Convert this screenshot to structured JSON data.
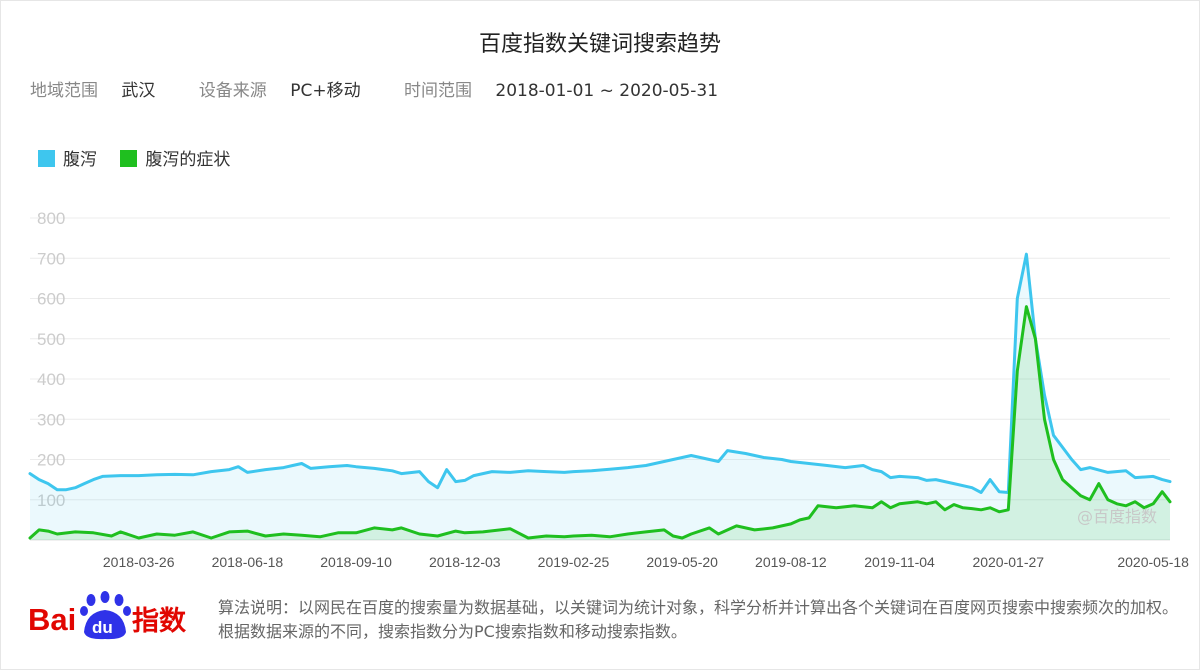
{
  "header": {
    "title": "百度指数关键词搜索趋势"
  },
  "filters": {
    "region_label": "地域范围",
    "region": "武汉",
    "device_label": "设备来源",
    "device": "PC+移动",
    "time_label": "时间范围",
    "time_range": "2018-01-01 ~ 2020-05-31"
  },
  "colors": {
    "series1": "#3ec6ee",
    "series2": "#1fbf1f"
  },
  "watermark": "@百度指数",
  "footer": {
    "logo_bai": "Bai",
    "logo_du": "du",
    "logo_zhishu": "指数",
    "note": "算法说明：以网民在百度的搜索量为数据基础，以关键词为统计对象，科学分析并计算出各个关键词在百度网页搜索中搜索频次的加权。根据数据来源的不同，搜索指数分为PC搜索指数和移动搜索指数。"
  },
  "chart_data": {
    "type": "area",
    "ylim": [
      0,
      800
    ],
    "yticks": [
      100,
      200,
      300,
      400,
      500,
      600,
      700,
      800
    ],
    "grid": true,
    "legend_position": "top-left",
    "x_start": "2018-01-01",
    "x_end": "2020-05-31",
    "xticks": [
      "2018-03-26",
      "2018-06-18",
      "2018-09-10",
      "2018-12-03",
      "2019-02-25",
      "2019-05-20",
      "2019-08-12",
      "2019-11-04",
      "2020-01-27",
      "2020-05-18"
    ],
    "series": [
      {
        "name": "腹泻",
        "points": [
          [
            "2018-01-01",
            165
          ],
          [
            "2018-01-08",
            150
          ],
          [
            "2018-01-15",
            140
          ],
          [
            "2018-01-22",
            125
          ],
          [
            "2018-01-29",
            125
          ],
          [
            "2018-02-05",
            130
          ],
          [
            "2018-02-12",
            140
          ],
          [
            "2018-02-19",
            150
          ],
          [
            "2018-02-26",
            158
          ],
          [
            "2018-03-12",
            160
          ],
          [
            "2018-03-26",
            160
          ],
          [
            "2018-04-09",
            162
          ],
          [
            "2018-04-23",
            163
          ],
          [
            "2018-05-07",
            162
          ],
          [
            "2018-05-21",
            170
          ],
          [
            "2018-06-04",
            175
          ],
          [
            "2018-06-11",
            182
          ],
          [
            "2018-06-18",
            168
          ],
          [
            "2018-07-02",
            175
          ],
          [
            "2018-07-16",
            180
          ],
          [
            "2018-07-23",
            185
          ],
          [
            "2018-07-30",
            190
          ],
          [
            "2018-08-06",
            178
          ],
          [
            "2018-08-20",
            182
          ],
          [
            "2018-09-03",
            185
          ],
          [
            "2018-09-10",
            182
          ],
          [
            "2018-09-24",
            178
          ],
          [
            "2018-10-08",
            172
          ],
          [
            "2018-10-15",
            165
          ],
          [
            "2018-10-29",
            170
          ],
          [
            "2018-11-05",
            145
          ],
          [
            "2018-11-12",
            130
          ],
          [
            "2018-11-19",
            175
          ],
          [
            "2018-11-26",
            145
          ],
          [
            "2018-12-03",
            148
          ],
          [
            "2018-12-10",
            160
          ],
          [
            "2018-12-24",
            170
          ],
          [
            "2019-01-07",
            168
          ],
          [
            "2019-01-21",
            172
          ],
          [
            "2019-02-04",
            170
          ],
          [
            "2019-02-18",
            168
          ],
          [
            "2019-02-25",
            170
          ],
          [
            "2019-03-11",
            172
          ],
          [
            "2019-03-25",
            176
          ],
          [
            "2019-04-08",
            180
          ],
          [
            "2019-04-22",
            185
          ],
          [
            "2019-05-06",
            195
          ],
          [
            "2019-05-20",
            205
          ],
          [
            "2019-05-27",
            210
          ],
          [
            "2019-06-03",
            205
          ],
          [
            "2019-06-17",
            195
          ],
          [
            "2019-06-24",
            222
          ],
          [
            "2019-07-08",
            215
          ],
          [
            "2019-07-22",
            205
          ],
          [
            "2019-08-05",
            200
          ],
          [
            "2019-08-12",
            195
          ],
          [
            "2019-08-26",
            190
          ],
          [
            "2019-09-09",
            185
          ],
          [
            "2019-09-23",
            180
          ],
          [
            "2019-10-07",
            185
          ],
          [
            "2019-10-14",
            175
          ],
          [
            "2019-10-21",
            170
          ],
          [
            "2019-10-28",
            155
          ],
          [
            "2019-11-04",
            158
          ],
          [
            "2019-11-18",
            155
          ],
          [
            "2019-11-25",
            148
          ],
          [
            "2019-12-02",
            150
          ],
          [
            "2019-12-16",
            140
          ],
          [
            "2019-12-30",
            130
          ],
          [
            "2020-01-06",
            118
          ],
          [
            "2020-01-13",
            150
          ],
          [
            "2020-01-20",
            120
          ],
          [
            "2020-01-27",
            118
          ],
          [
            "2020-02-03",
            600
          ],
          [
            "2020-02-10",
            710
          ],
          [
            "2020-02-17",
            500
          ],
          [
            "2020-02-24",
            360
          ],
          [
            "2020-03-02",
            260
          ],
          [
            "2020-03-09",
            230
          ],
          [
            "2020-03-16",
            200
          ],
          [
            "2020-03-23",
            175
          ],
          [
            "2020-03-30",
            180
          ],
          [
            "2020-04-13",
            168
          ],
          [
            "2020-04-27",
            172
          ],
          [
            "2020-05-04",
            155
          ],
          [
            "2020-05-18",
            158
          ],
          [
            "2020-05-25",
            150
          ],
          [
            "2020-05-31",
            145
          ]
        ]
      },
      {
        "name": "腹泻的症状",
        "points": [
          [
            "2018-01-01",
            5
          ],
          [
            "2018-01-08",
            25
          ],
          [
            "2018-01-15",
            22
          ],
          [
            "2018-01-22",
            15
          ],
          [
            "2018-02-05",
            20
          ],
          [
            "2018-02-19",
            18
          ],
          [
            "2018-03-05",
            10
          ],
          [
            "2018-03-12",
            20
          ],
          [
            "2018-03-26",
            5
          ],
          [
            "2018-04-09",
            15
          ],
          [
            "2018-04-23",
            12
          ],
          [
            "2018-05-07",
            20
          ],
          [
            "2018-05-21",
            5
          ],
          [
            "2018-06-04",
            20
          ],
          [
            "2018-06-18",
            22
          ],
          [
            "2018-07-02",
            10
          ],
          [
            "2018-07-16",
            15
          ],
          [
            "2018-07-30",
            12
          ],
          [
            "2018-08-13",
            8
          ],
          [
            "2018-08-27",
            18
          ],
          [
            "2018-09-10",
            18
          ],
          [
            "2018-09-24",
            30
          ],
          [
            "2018-10-08",
            25
          ],
          [
            "2018-10-15",
            30
          ],
          [
            "2018-10-29",
            15
          ],
          [
            "2018-11-12",
            10
          ],
          [
            "2018-11-26",
            22
          ],
          [
            "2018-12-03",
            18
          ],
          [
            "2018-12-17",
            20
          ],
          [
            "2019-01-07",
            28
          ],
          [
            "2019-01-21",
            5
          ],
          [
            "2019-02-04",
            10
          ],
          [
            "2019-02-18",
            8
          ],
          [
            "2019-02-25",
            10
          ],
          [
            "2019-03-11",
            12
          ],
          [
            "2019-03-25",
            8
          ],
          [
            "2019-04-08",
            15
          ],
          [
            "2019-04-22",
            20
          ],
          [
            "2019-05-06",
            25
          ],
          [
            "2019-05-13",
            10
          ],
          [
            "2019-05-20",
            5
          ],
          [
            "2019-05-27",
            15
          ],
          [
            "2019-06-10",
            30
          ],
          [
            "2019-06-17",
            15
          ],
          [
            "2019-07-01",
            35
          ],
          [
            "2019-07-15",
            25
          ],
          [
            "2019-07-29",
            30
          ],
          [
            "2019-08-12",
            40
          ],
          [
            "2019-08-19",
            50
          ],
          [
            "2019-08-26",
            55
          ],
          [
            "2019-09-02",
            85
          ],
          [
            "2019-09-16",
            80
          ],
          [
            "2019-09-30",
            85
          ],
          [
            "2019-10-14",
            80
          ],
          [
            "2019-10-21",
            95
          ],
          [
            "2019-10-28",
            80
          ],
          [
            "2019-11-04",
            90
          ],
          [
            "2019-11-18",
            95
          ],
          [
            "2019-11-25",
            90
          ],
          [
            "2019-12-02",
            95
          ],
          [
            "2019-12-09",
            75
          ],
          [
            "2019-12-16",
            88
          ],
          [
            "2019-12-23",
            80
          ],
          [
            "2019-12-30",
            78
          ],
          [
            "2020-01-06",
            75
          ],
          [
            "2020-01-13",
            80
          ],
          [
            "2020-01-20",
            70
          ],
          [
            "2020-01-27",
            75
          ],
          [
            "2020-02-03",
            420
          ],
          [
            "2020-02-10",
            580
          ],
          [
            "2020-02-17",
            500
          ],
          [
            "2020-02-24",
            300
          ],
          [
            "2020-03-02",
            200
          ],
          [
            "2020-03-09",
            150
          ],
          [
            "2020-03-16",
            130
          ],
          [
            "2020-03-23",
            110
          ],
          [
            "2020-03-30",
            100
          ],
          [
            "2020-04-06",
            140
          ],
          [
            "2020-04-13",
            100
          ],
          [
            "2020-04-20",
            90
          ],
          [
            "2020-04-27",
            85
          ],
          [
            "2020-05-04",
            95
          ],
          [
            "2020-05-11",
            80
          ],
          [
            "2020-05-18",
            90
          ],
          [
            "2020-05-25",
            120
          ],
          [
            "2020-05-31",
            95
          ]
        ]
      }
    ]
  }
}
